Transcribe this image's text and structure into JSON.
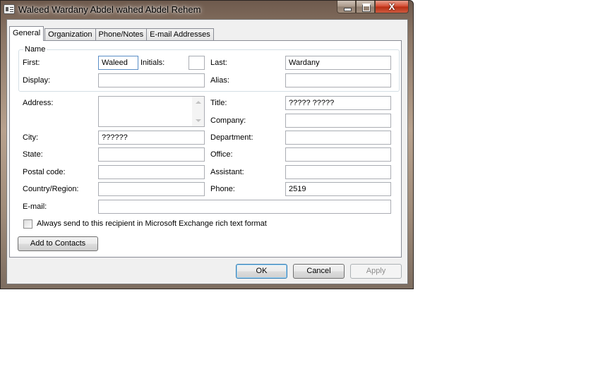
{
  "window": {
    "title": "Waleed Wardany Abdel wahed Abdel Rehem",
    "close_glyph": "X"
  },
  "tabs": [
    {
      "label": "General",
      "active": true
    },
    {
      "label": "Organization",
      "active": false
    },
    {
      "label": "Phone/Notes",
      "active": false
    },
    {
      "label": "E-mail Addresses",
      "active": false
    }
  ],
  "name_group": {
    "legend": "Name",
    "first_label": "First:",
    "first_value": "Waleed",
    "initials_label": "Initials:",
    "initials_value": "",
    "last_label": "Last:",
    "last_value": "Wardany",
    "display_label": "Display:",
    "display_value": "",
    "alias_label": "Alias:",
    "alias_value": ""
  },
  "fields": {
    "address_label": "Address:",
    "address_value": "",
    "title_label": "Title:",
    "title_value": "????? ?????",
    "company_label": "Company:",
    "company_value": "",
    "city_label": "City:",
    "city_value": "??????",
    "department_label": "Department:",
    "department_value": "",
    "state_label": "State:",
    "state_value": "",
    "office_label": "Office:",
    "office_value": "",
    "postal_label": "Postal code:",
    "postal_value": "",
    "assistant_label": "Assistant:",
    "assistant_value": "",
    "country_label": "Country/Region:",
    "country_value": "",
    "phone_label": "Phone:",
    "phone_value": "2519",
    "email_label": "E-mail:",
    "email_value": ""
  },
  "rich_text_checkbox": {
    "label": "Always send to this recipient in Microsoft Exchange rich text format",
    "checked": false
  },
  "buttons": {
    "add_to_contacts": "Add to Contacts",
    "ok": "OK",
    "cancel": "Cancel",
    "apply": "Apply"
  },
  "colors": {
    "focus_border": "#5a8ec6",
    "close_button": "#c6391c",
    "dialog_background": "#f0f0f0"
  }
}
